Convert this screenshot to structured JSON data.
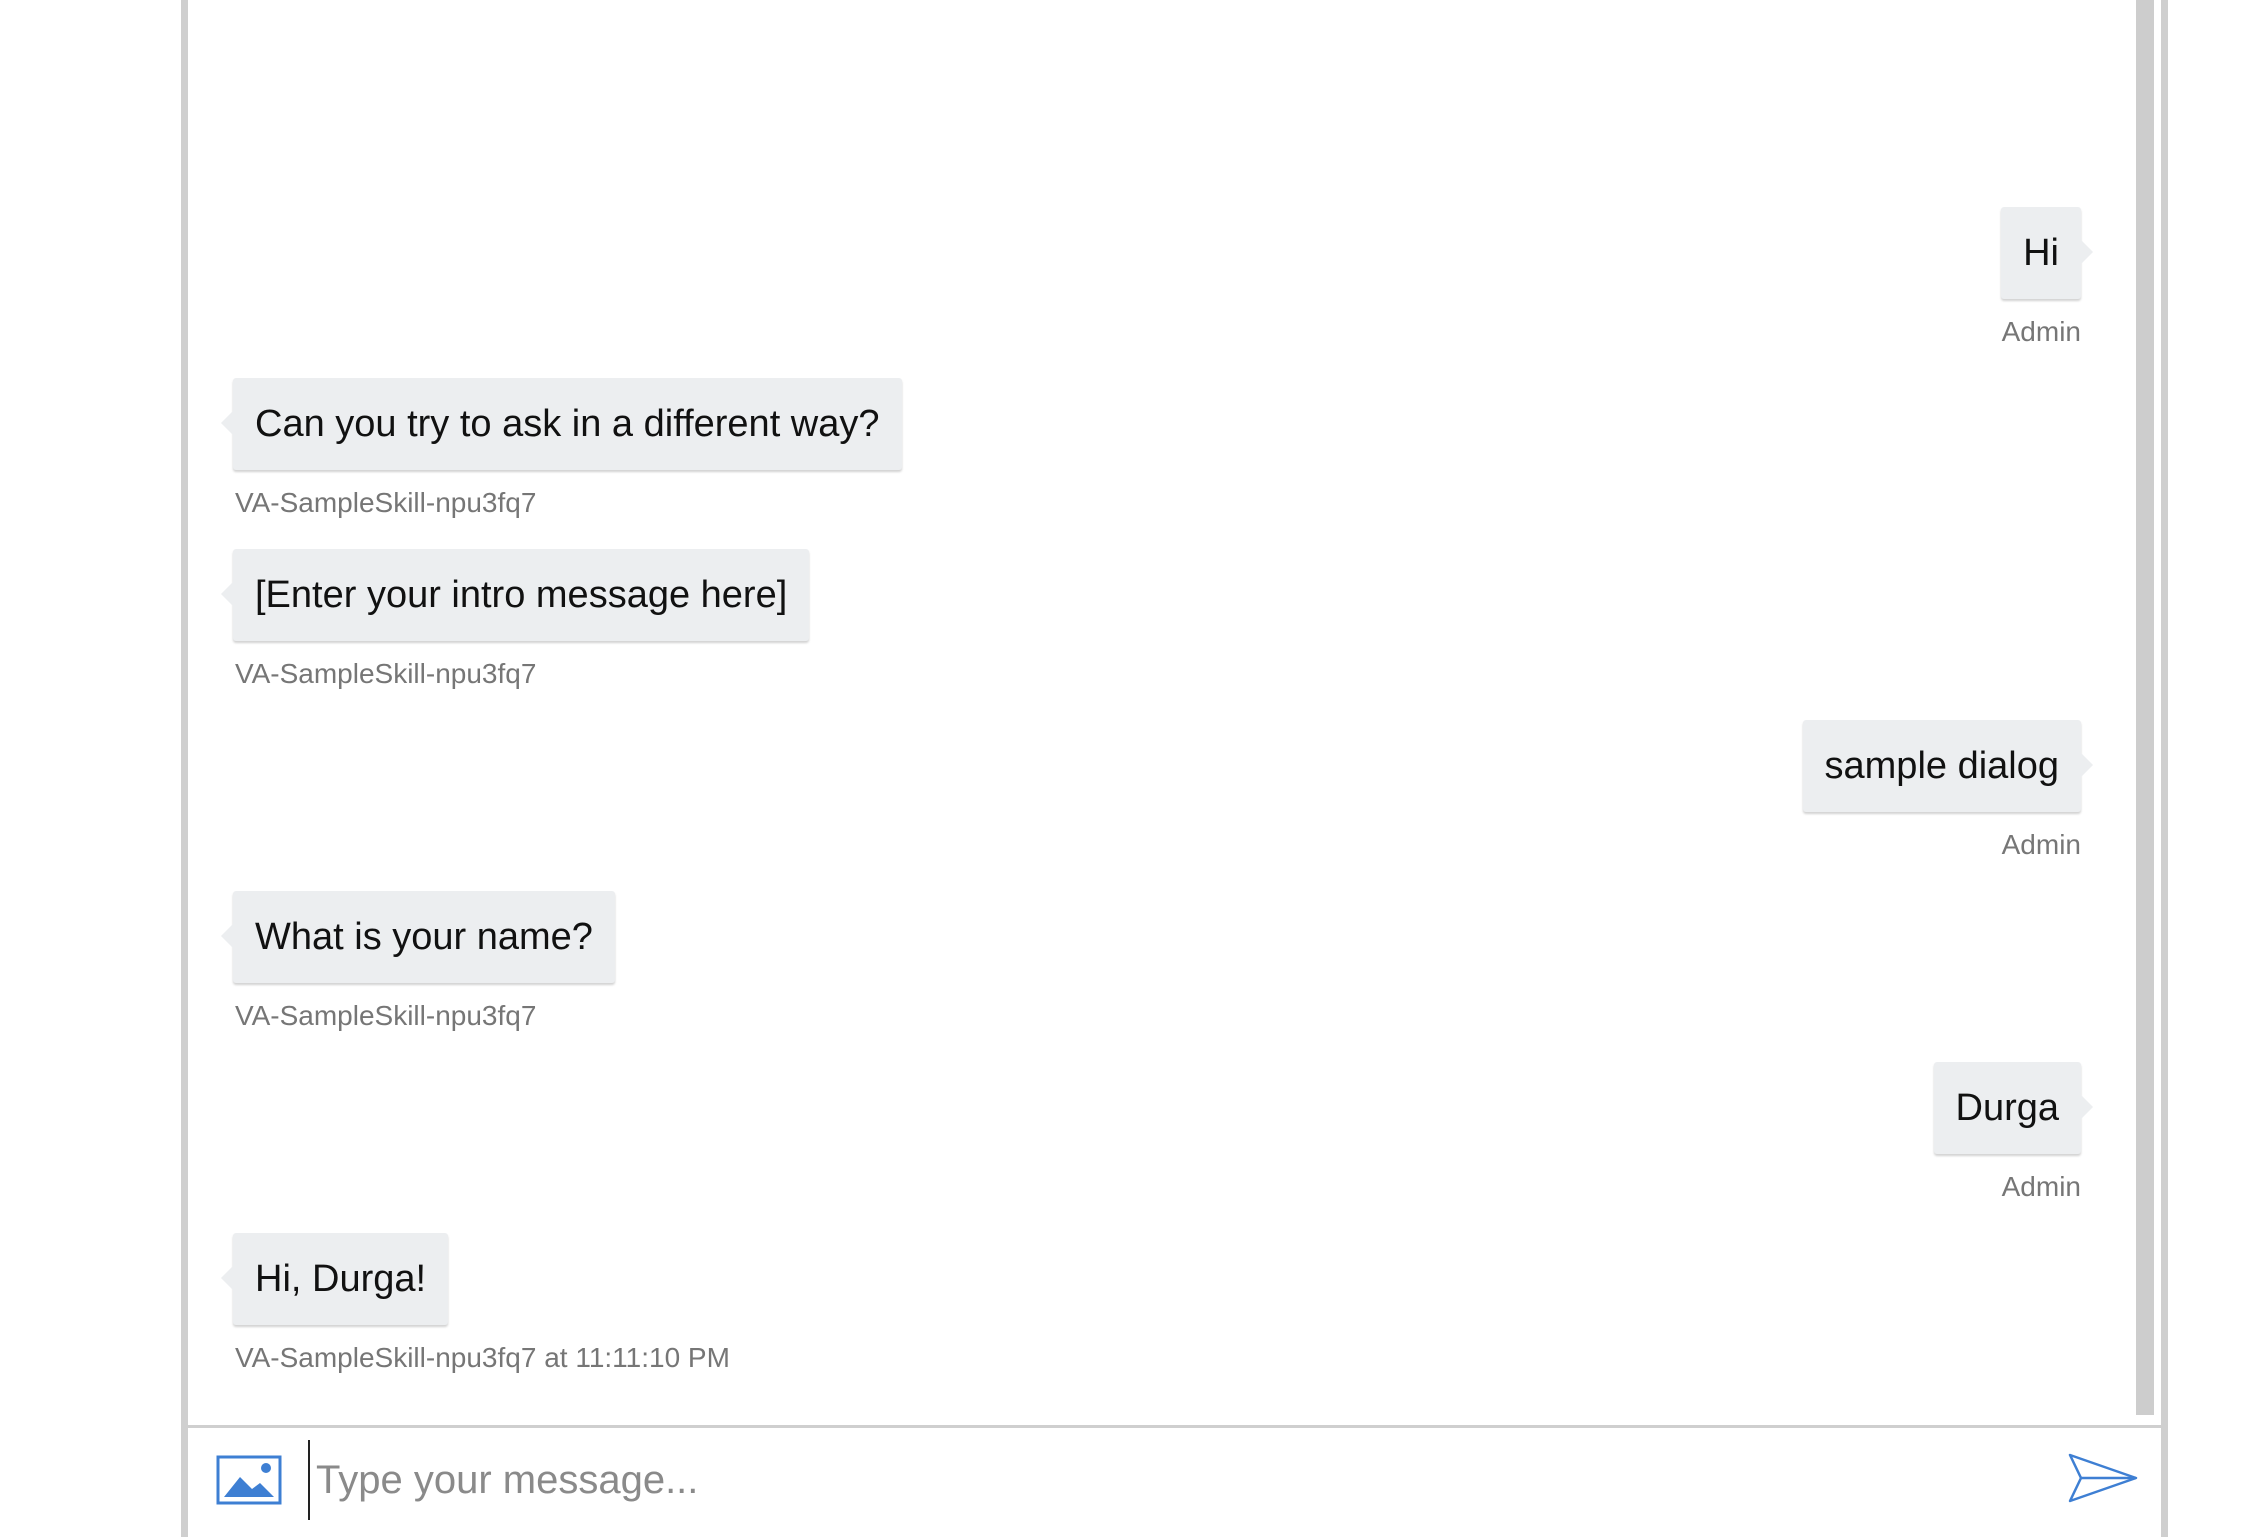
{
  "conversation": {
    "messages": [
      {
        "role": "user",
        "text": "Hi",
        "from": "Admin"
      },
      {
        "role": "bot",
        "text": "Can you try to ask in a different way?",
        "from": "VA-SampleSkill-npu3fq7"
      },
      {
        "role": "bot",
        "text": "[Enter your intro message here]",
        "from": "VA-SampleSkill-npu3fq7"
      },
      {
        "role": "user",
        "text": "sample dialog",
        "from": "Admin"
      },
      {
        "role": "bot",
        "text": "What is your name?",
        "from": "VA-SampleSkill-npu3fq7"
      },
      {
        "role": "user",
        "text": "Durga",
        "from": "Admin"
      },
      {
        "role": "bot",
        "text": "Hi, Durga!",
        "from": "VA-SampleSkill-npu3fq7 at 11:11:10 PM"
      }
    ]
  },
  "input_bar": {
    "placeholder": "Type your message...",
    "value": "",
    "attach_icon": "image-icon",
    "send_icon": "send-icon"
  },
  "colors": {
    "bubble_bg": "#eceef0",
    "meta_text": "#767676",
    "icon_blue": "#3e7fd3",
    "frame_border": "#cfcfcf"
  }
}
